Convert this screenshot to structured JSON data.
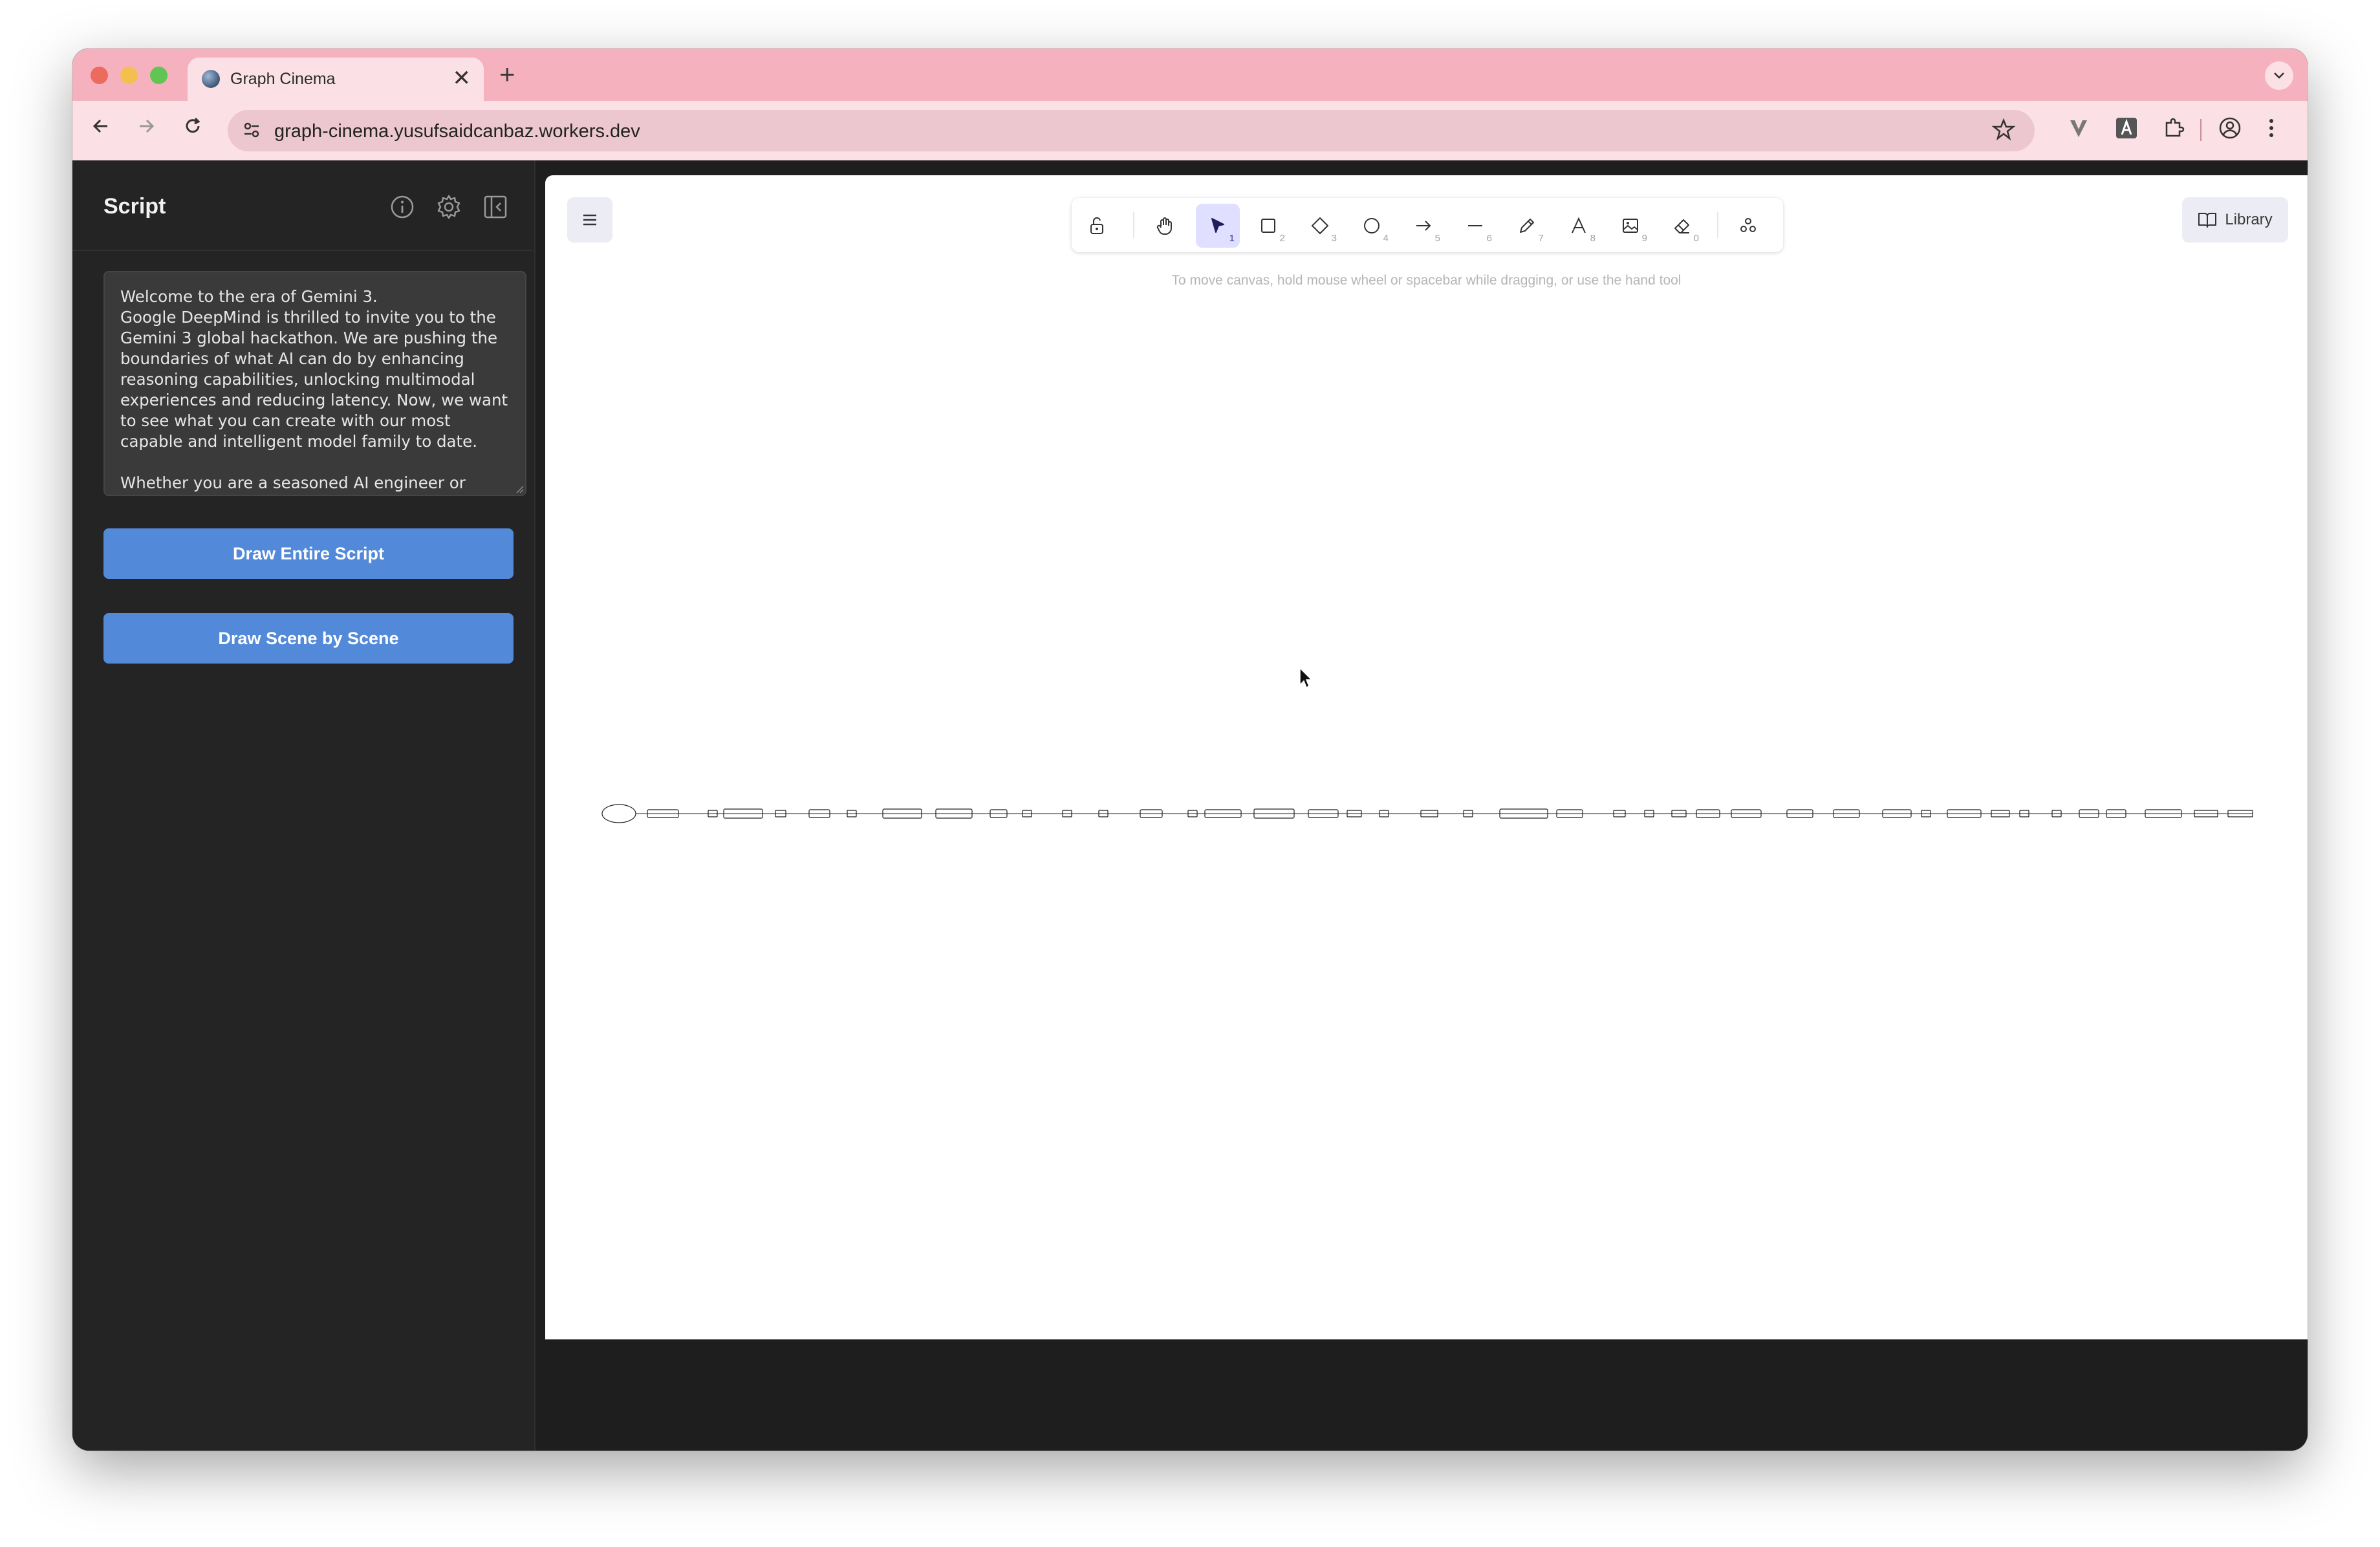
{
  "browser": {
    "tab_title": "Graph Cinema",
    "tab_close": "✕",
    "new_tab": "+",
    "url": "graph-cinema.yusufsaidcanbaz.workers.dev"
  },
  "sidebar": {
    "title": "Script",
    "script_text": "Welcome to the era of Gemini 3.\nGoogle DeepMind is thrilled to invite you to the Gemini 3 global hackathon. We are pushing the boundaries of what AI can do by enhancing reasoning capabilities, unlocking multimodal experiences and reducing latency. Now, we want to see what you can create with our most capable and intelligent model family to date.\n\nWhether you are a seasoned AI engineer or",
    "draw_entire_label": "Draw Entire Script",
    "draw_scene_label": "Draw Scene by Scene"
  },
  "canvas": {
    "hint": "To move canvas, hold mouse wheel or spacebar while dragging, or use the hand tool",
    "library_label": "Library",
    "tools": [
      {
        "name": "lock",
        "key": ""
      },
      {
        "name": "hand",
        "key": ""
      },
      {
        "name": "selection",
        "key": "1",
        "active": true
      },
      {
        "name": "rectangle",
        "key": "2"
      },
      {
        "name": "diamond",
        "key": "3"
      },
      {
        "name": "ellipse",
        "key": "4"
      },
      {
        "name": "arrow",
        "key": "5"
      },
      {
        "name": "line",
        "key": "6"
      },
      {
        "name": "draw",
        "key": "7"
      },
      {
        "name": "text",
        "key": "8"
      },
      {
        "name": "image",
        "key": "9"
      },
      {
        "name": "eraser",
        "key": "0"
      },
      {
        "name": "extra-tools",
        "key": ""
      }
    ]
  },
  "colors": {
    "tabstrip": "#f5b1be",
    "toolbar": "#fbe0e5",
    "button": "#5389d9",
    "active_tool": "#e0dfff"
  }
}
